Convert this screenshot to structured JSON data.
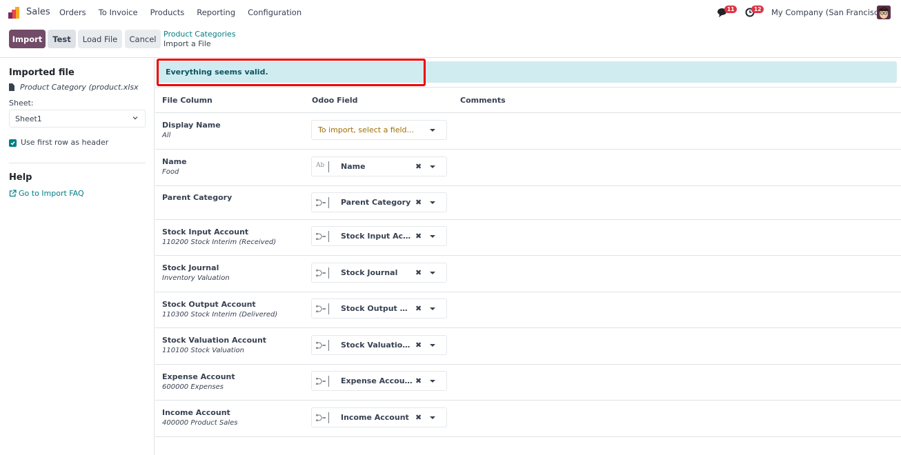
{
  "navbar": {
    "app_name": "Sales",
    "menu": [
      "Orders",
      "To Invoice",
      "Products",
      "Reporting",
      "Configuration"
    ],
    "messages_count": "11",
    "activities_count": "12",
    "company": "My Company (San Francisco)",
    "brand_colors": {
      "primary": "#714b67",
      "accent": "#017e84",
      "badge": "#dc3545"
    }
  },
  "control_panel": {
    "buttons": {
      "import": "Import",
      "test": "Test",
      "load_file": "Load File",
      "cancel": "Cancel"
    },
    "breadcrumb": {
      "parent": "Product Categories",
      "current": "Import a File"
    }
  },
  "sidebar": {
    "imported_file_title": "Imported file",
    "file_name": "Product Category (product.xlsx",
    "sheet_label": "Sheet:",
    "sheet_value": "Sheet1",
    "use_header_label": "Use first row as header",
    "use_header_checked": true,
    "help_title": "Help",
    "faq_link": "Go to Import FAQ"
  },
  "alert": {
    "message": "Everything seems valid.",
    "type": "info"
  },
  "table": {
    "headers": {
      "file_column": "File Column",
      "odoo_field": "Odoo Field",
      "comments": "Comments"
    },
    "rows": [
      {
        "column": "Display Name",
        "sample": "All",
        "field": null,
        "placeholder": "To import, select a field...",
        "field_type": null
      },
      {
        "column": "Name",
        "sample": "Food",
        "field": "Name",
        "field_type": "char"
      },
      {
        "column": "Parent Category",
        "sample": "",
        "field": "Parent Category",
        "field_type": "relation"
      },
      {
        "column": "Stock Input Account",
        "sample": "110200 Stock Interim (Received)",
        "field": "Stock Input Acco...",
        "field_type": "relation"
      },
      {
        "column": "Stock Journal",
        "sample": "Inventory Valuation",
        "field": "Stock Journal",
        "field_type": "relation"
      },
      {
        "column": "Stock Output Account",
        "sample": "110300 Stock Interim (Delivered)",
        "field": "Stock Output Acc...",
        "field_type": "relation"
      },
      {
        "column": "Stock Valuation Account",
        "sample": "110100 Stock Valuation",
        "field": "Stock Valuation A...",
        "field_type": "relation"
      },
      {
        "column": "Expense Account",
        "sample": "600000 Expenses",
        "field": "Expense Account",
        "field_type": "relation"
      },
      {
        "column": "Income Account",
        "sample": "400000 Product Sales",
        "field": "Income Account",
        "field_type": "relation"
      }
    ]
  }
}
